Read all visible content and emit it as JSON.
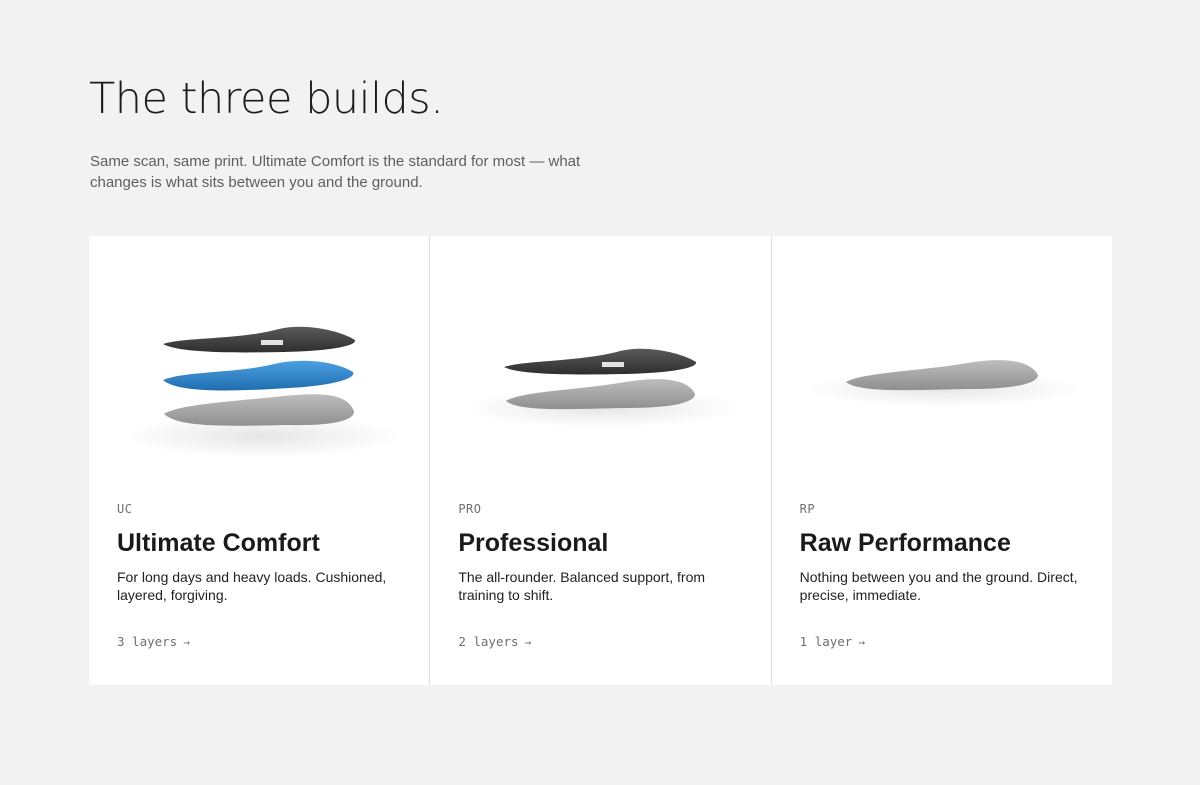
{
  "heading": "The three builds.",
  "intro": "Same scan, same print. Ultimate Comfort is the standard for most — what changes is what sits between you and the ground.",
  "colors": {
    "page_background": "#f2f2f2",
    "card_background": "#ffffff",
    "top_layer": "#3d3d3d",
    "cushion_layer": "#2f84c9",
    "base_layer": "#a5a5a5"
  },
  "cards": [
    {
      "code": "UC",
      "name": "Ultimate Comfort",
      "description": "For long days and heavy loads. Cushioned, layered, forgiving.",
      "layers_label": "3 layers",
      "arrow": "→",
      "image": "insole-three-layer-stack"
    },
    {
      "code": "PRO",
      "name": "Professional",
      "description": "The all-rounder. Balanced support, from training to shift.",
      "layers_label": "2 layers",
      "arrow": "→",
      "image": "insole-two-layer-stack"
    },
    {
      "code": "RP",
      "name": "Raw Performance",
      "description": "Nothing between you and the ground. Direct, precise, immediate.",
      "layers_label": "1 layer",
      "arrow": "→",
      "image": "insole-single-layer"
    }
  ]
}
